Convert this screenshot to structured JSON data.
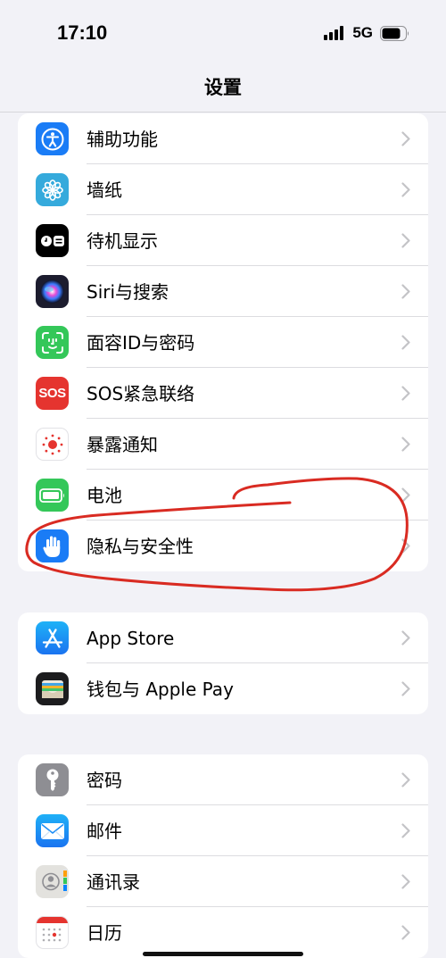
{
  "status_bar": {
    "time": "17:10",
    "network": "5G"
  },
  "nav": {
    "title": "设置"
  },
  "groups": [
    {
      "items": [
        {
          "label": "辅助功能",
          "icon": "accessibility-icon",
          "color": "#1a7cf6"
        },
        {
          "label": "墙纸",
          "icon": "wallpaper-icon",
          "color": "#35aadc"
        },
        {
          "label": "待机显示",
          "icon": "standby-icon",
          "color": "#000000"
        },
        {
          "label": "Siri与搜索",
          "icon": "siri-icon",
          "color": "#1c1c2e"
        },
        {
          "label": "面容ID与密码",
          "icon": "face-id-icon",
          "color": "#34c759"
        },
        {
          "label": "SOS紧急联络",
          "icon": "sos-icon",
          "color": "#e5342f",
          "icon_text": "SOS"
        },
        {
          "label": "暴露通知",
          "icon": "exposure-notification-icon",
          "color": "#ffffff"
        },
        {
          "label": "电池",
          "icon": "battery-icon",
          "color": "#34c759"
        },
        {
          "label": "隐私与安全性",
          "icon": "privacy-hand-icon",
          "color": "#1a7cf6"
        }
      ]
    },
    {
      "items": [
        {
          "label": "App Store",
          "icon": "app-store-icon",
          "color": "#1a8cf6"
        },
        {
          "label": "钱包与 Apple Pay",
          "icon": "wallet-icon",
          "color": "#1c1c1e"
        }
      ]
    },
    {
      "items": [
        {
          "label": "密码",
          "icon": "key-icon",
          "color": "#8e8e93"
        },
        {
          "label": "邮件",
          "icon": "mail-icon",
          "color": "#1a8cf6"
        },
        {
          "label": "通讯录",
          "icon": "contacts-icon",
          "color": "#d8d8d4"
        },
        {
          "label": "日历",
          "icon": "calendar-icon",
          "color": "#ffffff"
        }
      ]
    }
  ],
  "annotation": {
    "color": "#d92b22"
  }
}
